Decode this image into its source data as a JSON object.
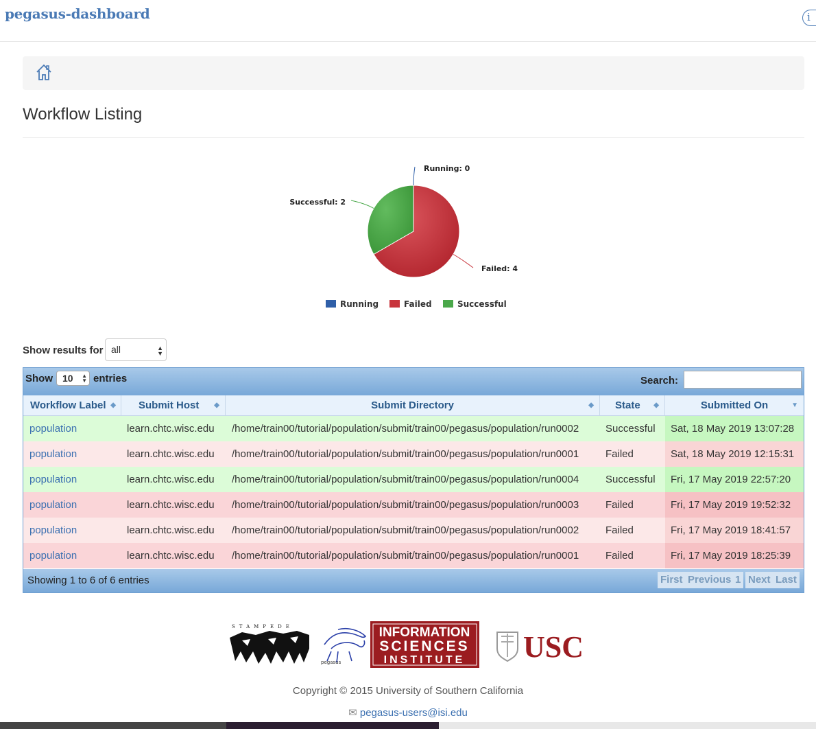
{
  "app": {
    "brand": "pegasus-dashboard",
    "info_icon": "info-icon"
  },
  "page": {
    "title": "Workflow Listing"
  },
  "chart_data": {
    "type": "pie",
    "slices": [
      {
        "label": "Running",
        "value": 0,
        "color": "#2f5fa8",
        "callout": "Running: 0"
      },
      {
        "label": "Failed",
        "value": 4,
        "color": "#c8343c",
        "callout": "Failed: 4"
      },
      {
        "label": "Successful",
        "value": 2,
        "color": "#4aa84a",
        "callout": "Successful: 2"
      }
    ],
    "legend": [
      "Running",
      "Failed",
      "Successful"
    ],
    "legend_position": "bottom"
  },
  "filter": {
    "label": "Show results for",
    "selected": "all"
  },
  "table": {
    "show_label": "Show",
    "entries_label": "entries",
    "page_length": "10",
    "search_label": "Search:",
    "search_value": "",
    "columns": [
      "Workflow Label",
      "Submit Host",
      "Submit Directory",
      "State",
      "Submitted On"
    ],
    "rows": [
      {
        "label": "population",
        "host": "learn.chtc.wisc.edu",
        "dir": "/home/train00/tutorial/population/submit/train00/pegasus/population/run0002",
        "state": "Successful",
        "submitted": "Sat, 18 May 2019 13:07:28"
      },
      {
        "label": "population",
        "host": "learn.chtc.wisc.edu",
        "dir": "/home/train00/tutorial/population/submit/train00/pegasus/population/run0001",
        "state": "Failed",
        "submitted": "Sat, 18 May 2019 12:15:31"
      },
      {
        "label": "population",
        "host": "learn.chtc.wisc.edu",
        "dir": "/home/train00/tutorial/population/submit/train00/pegasus/population/run0004",
        "state": "Successful",
        "submitted": "Fri, 17 May 2019 22:57:20"
      },
      {
        "label": "population",
        "host": "learn.chtc.wisc.edu",
        "dir": "/home/train00/tutorial/population/submit/train00/pegasus/population/run0003",
        "state": "Failed",
        "submitted": "Fri, 17 May 2019 19:52:32"
      },
      {
        "label": "population",
        "host": "learn.chtc.wisc.edu",
        "dir": "/home/train00/tutorial/population/submit/train00/pegasus/population/run0002",
        "state": "Failed",
        "submitted": "Fri, 17 May 2019 18:41:57"
      },
      {
        "label": "population",
        "host": "learn.chtc.wisc.edu",
        "dir": "/home/train00/tutorial/population/submit/train00/pegasus/population/run0001",
        "state": "Failed",
        "submitted": "Fri, 17 May 2019 18:25:39"
      }
    ],
    "row_colors": {
      "Successful": {
        "bg": "#dcfcd8",
        "date_bg": "#c6f7c0"
      },
      "Failed": {
        "bg": "#fce8e8",
        "date_bg": "#f9d5d5"
      },
      "Failed_alt": {
        "bg": "#fad5d8",
        "date_bg": "#f6c1c4"
      }
    },
    "footer_info": "Showing 1 to 6 of 6 entries",
    "pager": {
      "first": "First",
      "previous": "Previous",
      "page": "1",
      "next": "Next",
      "last": "Last"
    }
  },
  "footer": {
    "logos": {
      "stampede": "STAMPEDE",
      "pegasus": "pegasus",
      "isi_lines": [
        "INFORMATION",
        "SCIENCES",
        "INSTITUTE"
      ],
      "usc": "USC"
    },
    "copyright": "Copyright © 2015 University of Southern California",
    "email": "pegasus-users@isi.edu"
  }
}
